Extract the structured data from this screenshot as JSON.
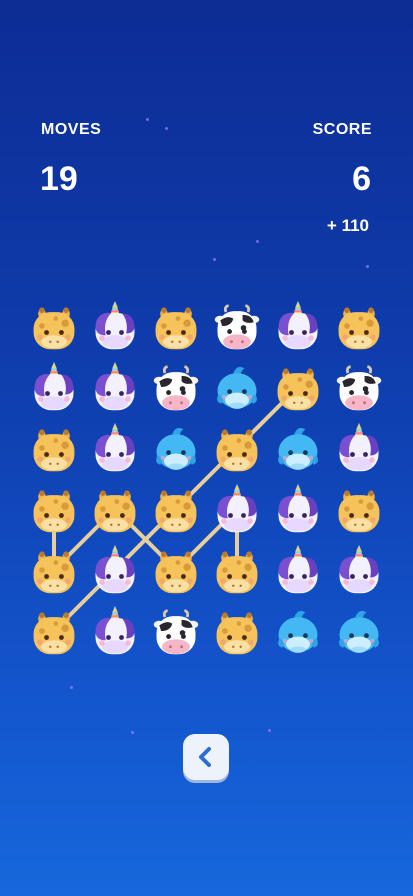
{
  "hud": {
    "moves_label": "MOVES",
    "moves_value": "19",
    "score_label": "SCORE",
    "score_value": "6",
    "score_delta": "+ 110"
  },
  "board": {
    "rows": [
      [
        "giraffe",
        "unicorn",
        "giraffe",
        "cow",
        "unicorn",
        "giraffe"
      ],
      [
        "unicorn",
        "unicorn",
        "cow",
        "dolphin",
        "giraffe",
        "cow"
      ],
      [
        "giraffe",
        "unicorn",
        "dolphin",
        "giraffe",
        "dolphin",
        "unicorn"
      ],
      [
        "giraffe",
        "giraffe",
        "giraffe",
        "unicorn",
        "unicorn",
        "giraffe"
      ],
      [
        "giraffe",
        "unicorn",
        "giraffe",
        "giraffe",
        "unicorn",
        "unicorn"
      ],
      [
        "giraffe",
        "unicorn",
        "cow",
        "giraffe",
        "dolphin",
        "dolphin"
      ]
    ],
    "link_paths": [
      [
        [
          0,
          3
        ],
        [
          0,
          4
        ]
      ],
      [
        [
          0,
          4
        ],
        [
          1,
          3
        ],
        [
          2,
          4
        ],
        [
          3,
          3
        ],
        [
          3,
          4
        ]
      ],
      [
        [
          0,
          5
        ],
        [
          1,
          4
        ],
        [
          2,
          3
        ],
        [
          3,
          2
        ],
        [
          4,
          1
        ]
      ]
    ]
  },
  "controls": {
    "back_icon": "chevron-left-icon"
  },
  "colors": {
    "bg_top": "#0d2c94",
    "bg_bottom": "#1668dc",
    "link_line": "#e7cf9c",
    "button_bg": "#eef3fb",
    "chevron": "#2b6cd6"
  }
}
